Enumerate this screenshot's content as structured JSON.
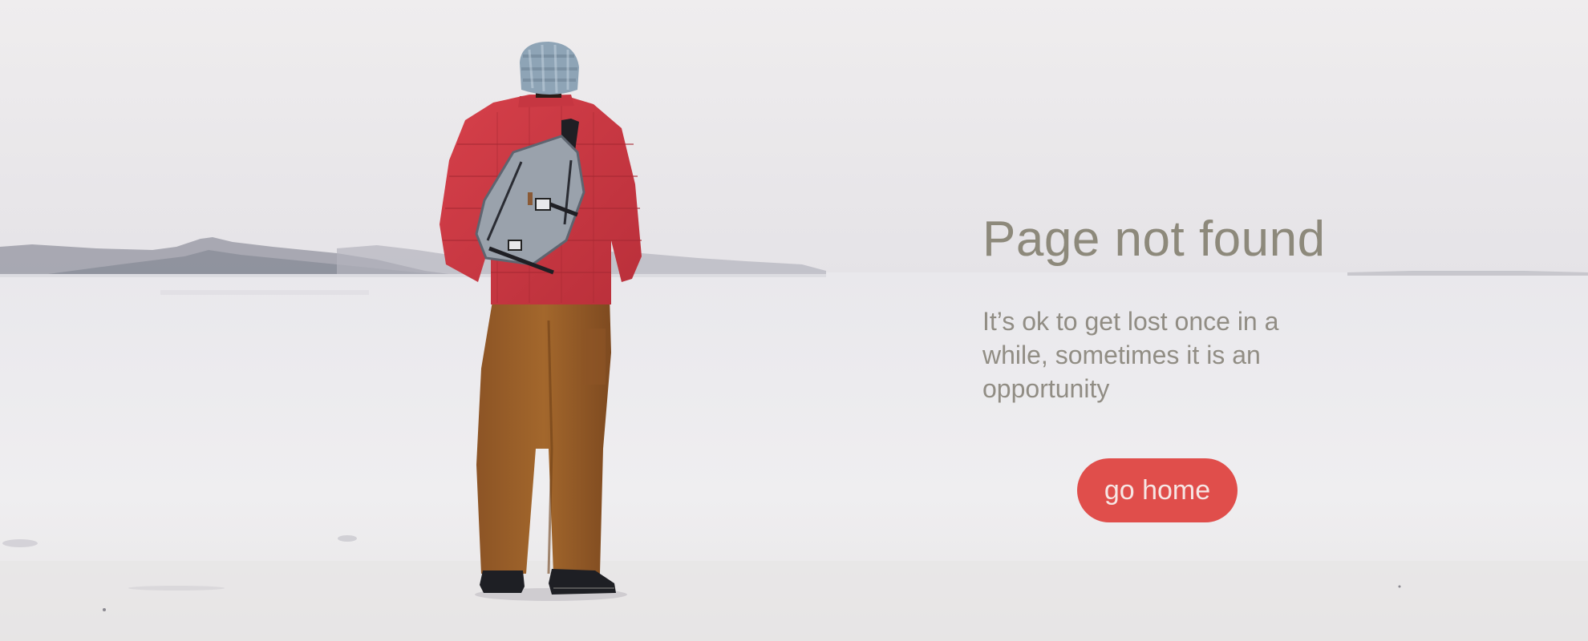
{
  "error_page": {
    "title": "Page not found",
    "message": "It’s ok to get lost once in a while, sometimes it is an opportunity",
    "home_button_label": "go home"
  },
  "colors": {
    "title": "#8d897b",
    "message": "#918d84",
    "button_background": "#e04e4b",
    "button_text": "#f6e6e4",
    "background": "#edebec"
  }
}
